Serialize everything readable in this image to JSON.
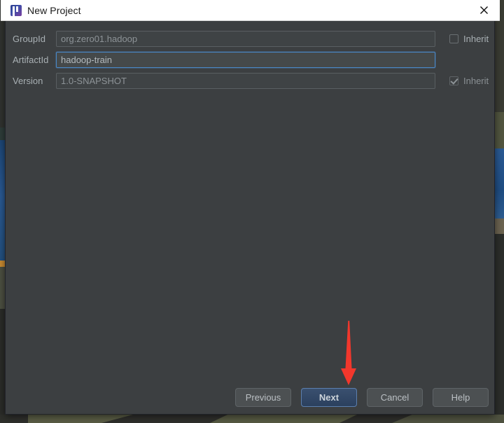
{
  "window": {
    "title": "New Project",
    "icon": "intellij-idea-icon",
    "close_label": "✕"
  },
  "form": {
    "rows": [
      {
        "label": "GroupId",
        "value": "org.zero01.hadoop",
        "state": "disabled",
        "inherit": {
          "label": "Inherit",
          "checked": false,
          "enabled": true
        }
      },
      {
        "label": "ArtifactId",
        "value": "hadoop-train",
        "state": "focused",
        "inherit": null
      },
      {
        "label": "Version",
        "value": "1.0-SNAPSHOT",
        "state": "disabled",
        "inherit": {
          "label": "Inherit",
          "checked": true,
          "enabled": false
        }
      }
    ]
  },
  "buttons": {
    "previous": "Previous",
    "next": "Next",
    "cancel": "Cancel",
    "help": "Help"
  },
  "annotation": {
    "type": "arrow-down",
    "color": "#f2372c",
    "points_to": "Next"
  },
  "colors": {
    "dialog_background": "#3c3f41",
    "titlebar_background": "#ffffff",
    "field_background": "#45494a",
    "focus_border": "#4a88c7",
    "primary_button": "#2b405e",
    "text": "#a9b0b4",
    "annotation_red": "#f2372c"
  }
}
